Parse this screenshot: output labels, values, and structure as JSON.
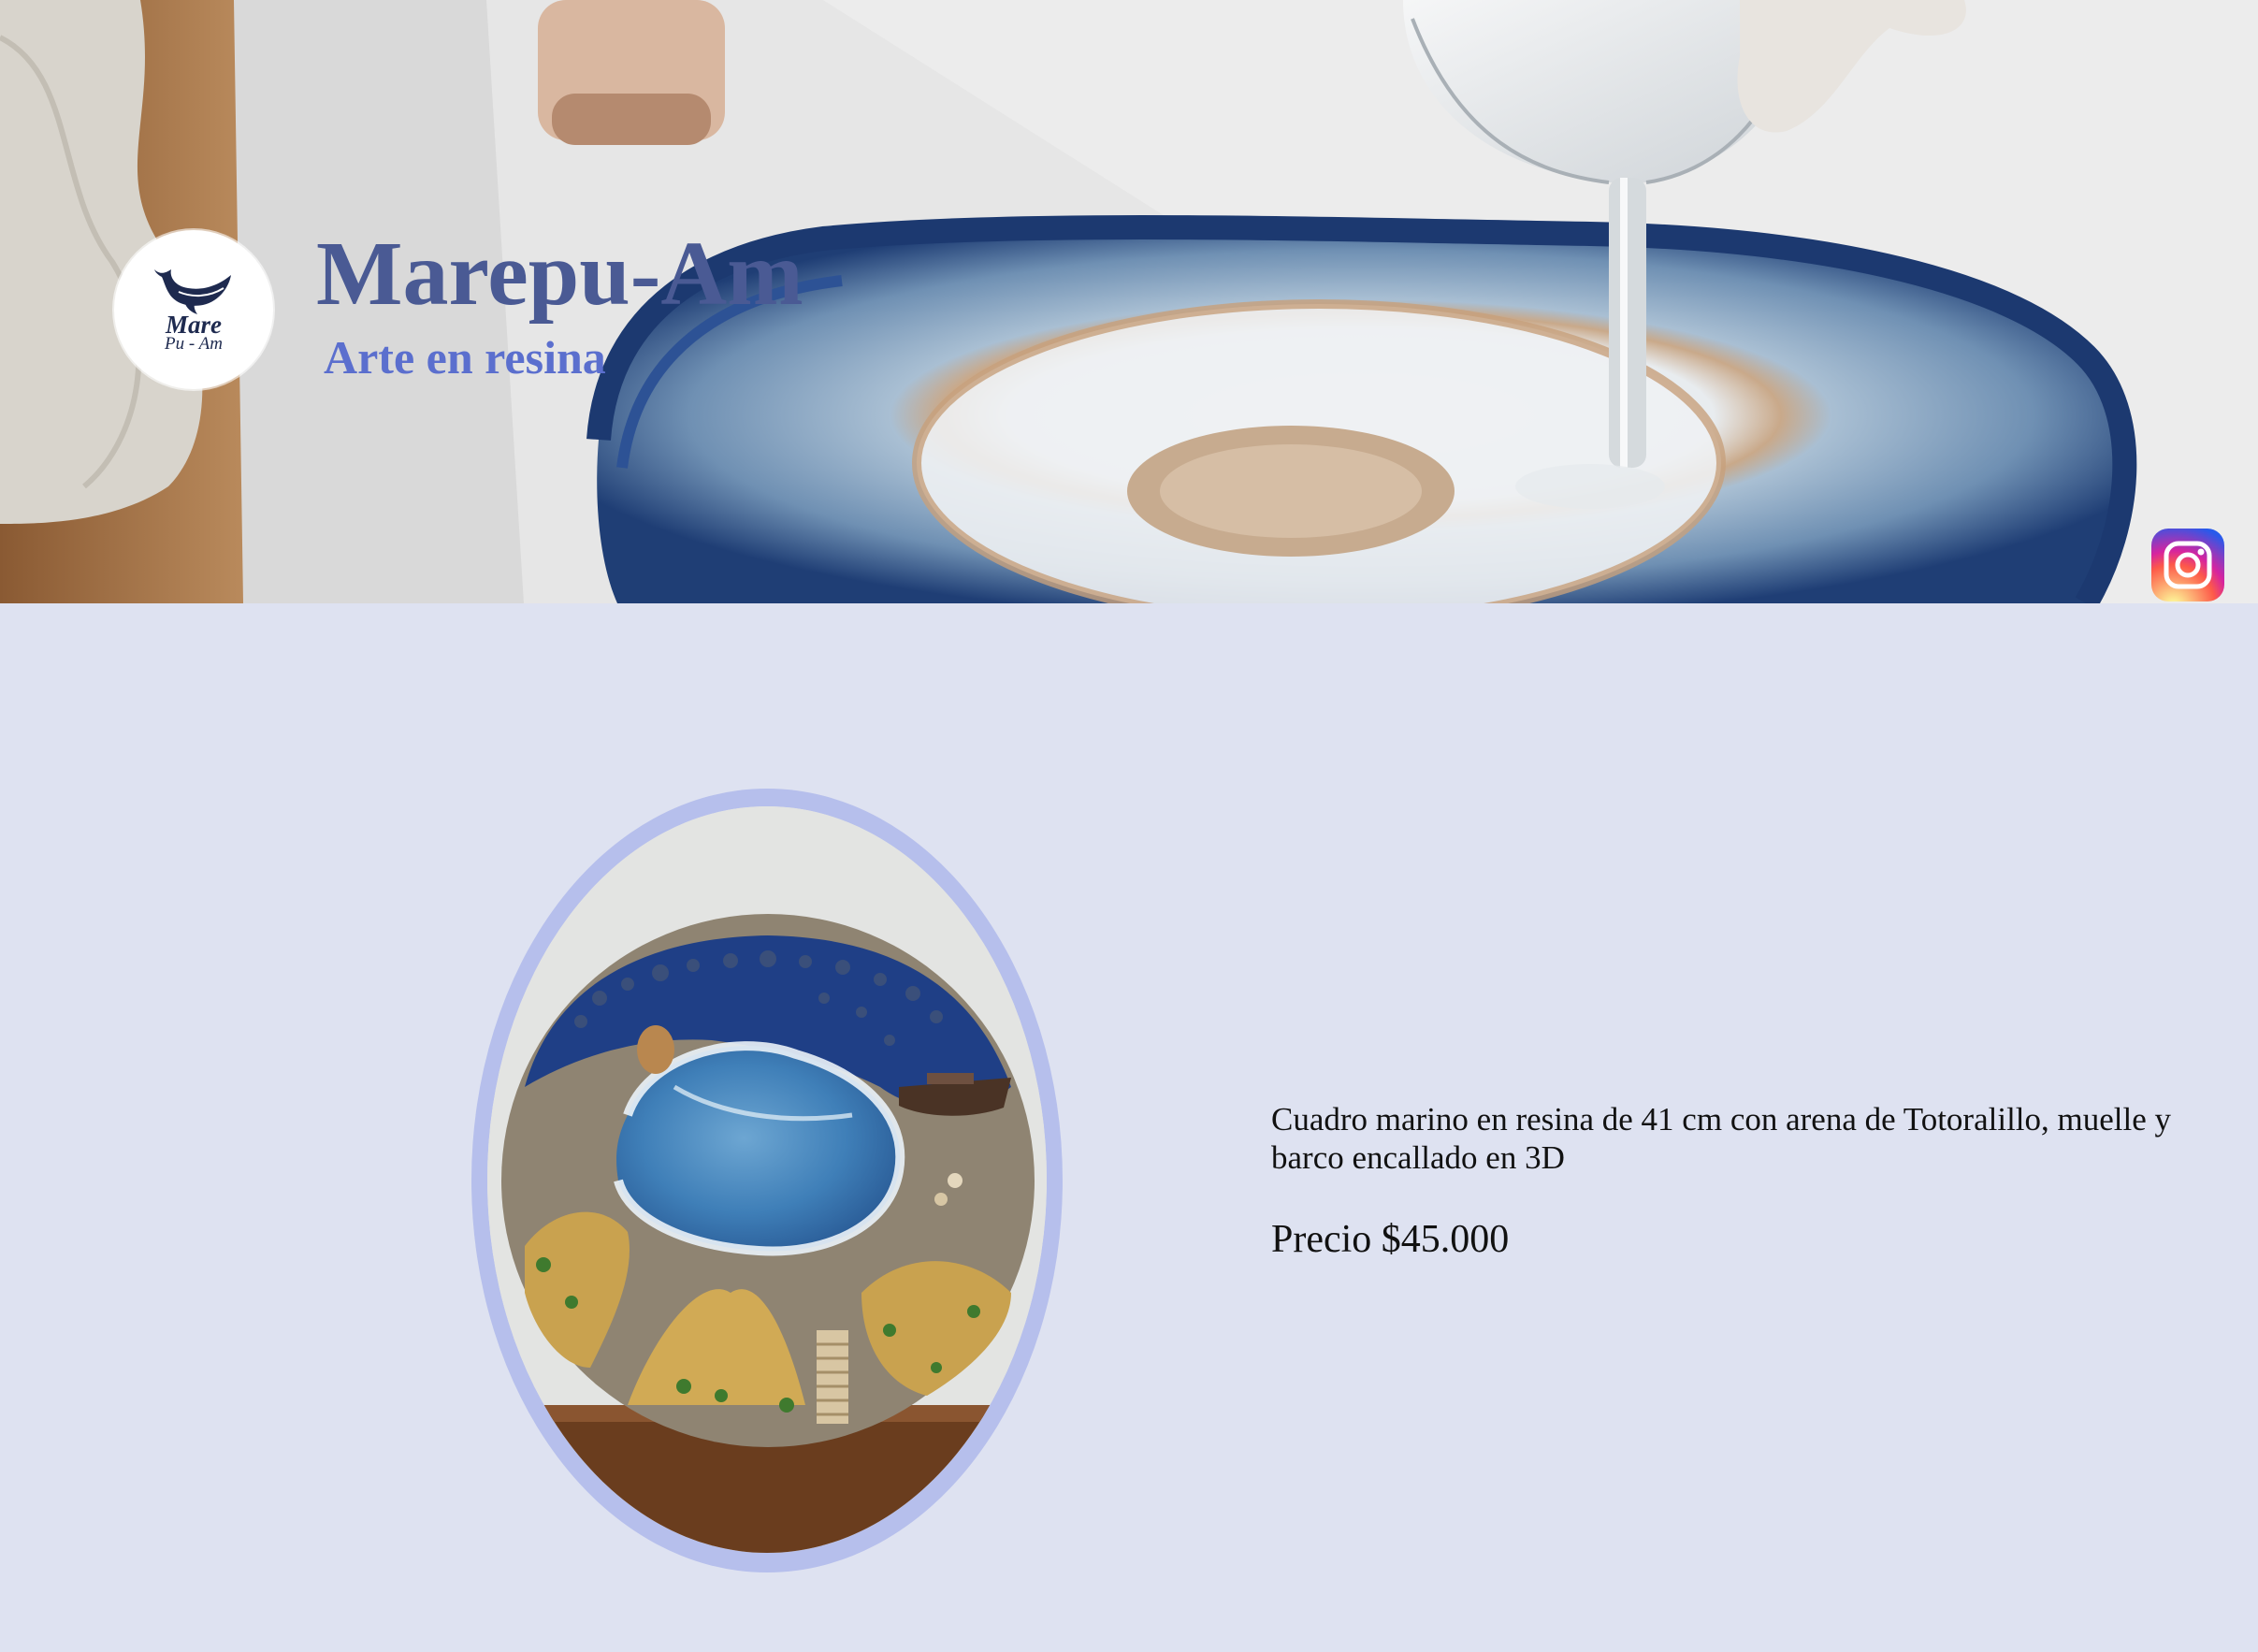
{
  "header": {
    "logo": {
      "line1": "Mare",
      "line2": "Pu - Am",
      "icon": "whale-icon"
    },
    "title": "Marepu-Am",
    "subtitle": "Arte en resina",
    "instagram_icon": "instagram-icon"
  },
  "product": {
    "description": "Cuadro marino en resina de 41 cm con arena de Totoralillo, muelle y barco encallado en 3D",
    "price": "Precio $45.000"
  },
  "colors": {
    "page_background": "#dee2f1",
    "title": "#4a5a94",
    "subtitle": "#5b6fce",
    "frame": "#b6bfec"
  }
}
